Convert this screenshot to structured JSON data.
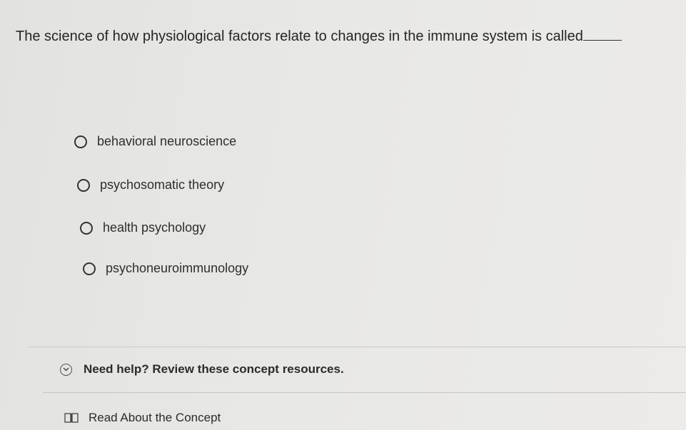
{
  "question": {
    "text": "The science of how physiological factors relate to changes in the immune system is called"
  },
  "options": [
    {
      "label": "behavioral neuroscience"
    },
    {
      "label": "psychosomatic theory"
    },
    {
      "label": "health psychology"
    },
    {
      "label": "psychoneuroimmunology"
    }
  ],
  "help": {
    "label": "Need help? Review these concept resources.",
    "icon": "chevron-down-icon"
  },
  "resources": {
    "read_label": "Read About the Concept",
    "icon": "book-icon"
  }
}
